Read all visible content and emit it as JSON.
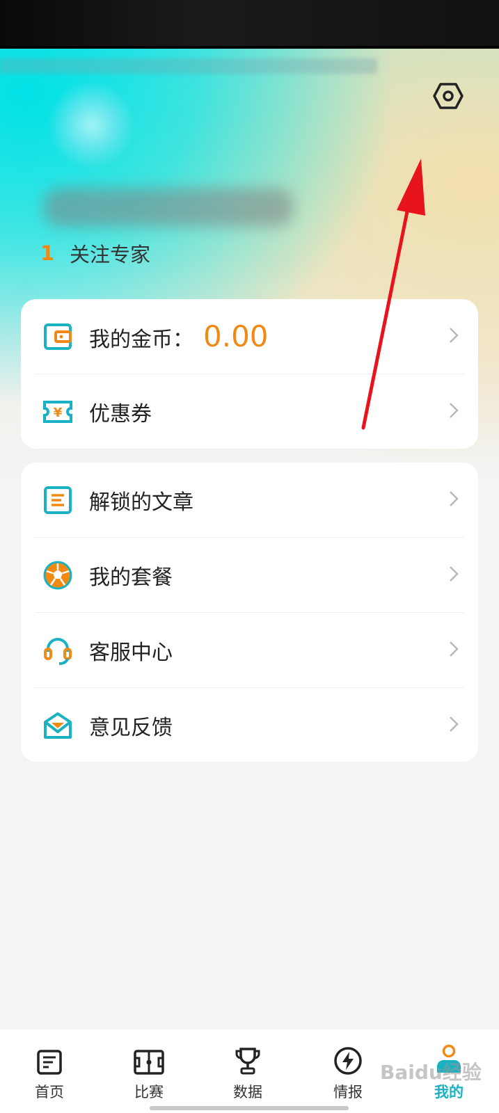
{
  "profile": {
    "follow_count": "1",
    "follow_label": "关注专家"
  },
  "wallet_card": {
    "coins_label": "我的金币：",
    "coins_value": "0.00",
    "coupon_label": "优惠券"
  },
  "menu_card": {
    "items": [
      {
        "label": "解锁的文章",
        "icon": "article-icon"
      },
      {
        "label": "我的套餐",
        "icon": "soccer-ball-icon"
      },
      {
        "label": "客服中心",
        "icon": "headset-icon"
      },
      {
        "label": "意见反馈",
        "icon": "mail-icon"
      }
    ]
  },
  "tabbar": {
    "tabs": [
      {
        "label": "首页",
        "icon": "news-icon"
      },
      {
        "label": "比赛",
        "icon": "pitch-icon"
      },
      {
        "label": "数据",
        "icon": "trophy-icon"
      },
      {
        "label": "情报",
        "icon": "lightning-icon"
      },
      {
        "label": "我的",
        "icon": "profile-icon",
        "active": true
      }
    ]
  },
  "watermark": "Baidu经验",
  "colors": {
    "accent": "#1ab2c2",
    "orange": "#f08a14",
    "annotation_arrow": "#e8141c"
  }
}
